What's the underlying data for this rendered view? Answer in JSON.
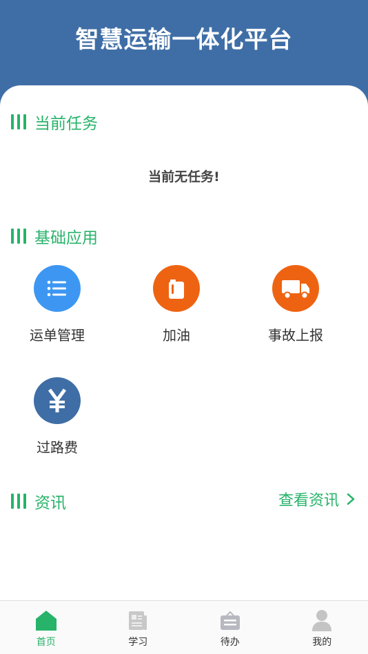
{
  "header": {
    "title": "智慧运输一体化平台"
  },
  "current_task": {
    "title": "当前任务",
    "empty_message": "当前无任务!"
  },
  "basic_apps": {
    "title": "基础应用",
    "items": [
      {
        "label": "运单管理",
        "icon": "list-icon",
        "color": "#3d97f2"
      },
      {
        "label": "加油",
        "icon": "fuel-can-icon",
        "color": "#ee6312"
      },
      {
        "label": "事故上报",
        "icon": "truck-icon",
        "color": "#ee6312"
      },
      {
        "label": "过路费",
        "icon": "yen-icon",
        "color": "#3f6ea6"
      }
    ]
  },
  "news": {
    "title": "资讯",
    "view_link": "查看资讯"
  },
  "tabbar": {
    "tabs": [
      {
        "label": "首页",
        "icon": "home-icon",
        "active": true
      },
      {
        "label": "学习",
        "icon": "newspaper-icon",
        "active": false
      },
      {
        "label": "待办",
        "icon": "inbox-icon",
        "active": false
      },
      {
        "label": "我的",
        "icon": "user-icon",
        "active": false
      }
    ]
  },
  "colors": {
    "brand": "#3f6ea6",
    "accent": "#27b36a"
  }
}
